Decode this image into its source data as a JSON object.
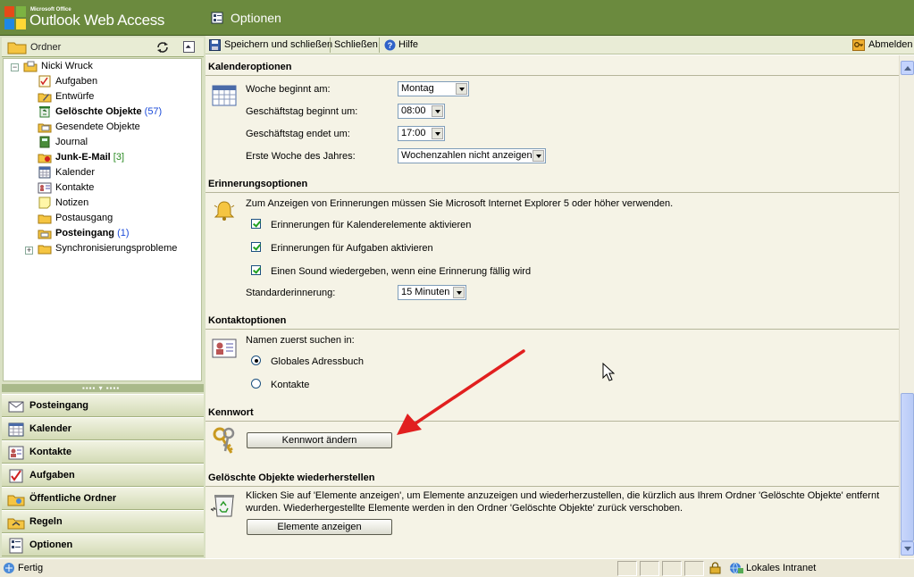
{
  "header": {
    "logo_small": "Microsoft Office",
    "logo_big": "Outlook Web Access",
    "title": "Optionen",
    "colors": {
      "header_bg": "#6b8a3e",
      "accent_red": "#e11f1f"
    }
  },
  "folders": {
    "header_label": "Ordner",
    "root": "Nicki Wruck",
    "items": [
      {
        "label": "Aufgaben",
        "count": "",
        "bold": false,
        "icon": "tasks-icon"
      },
      {
        "label": "Entwürfe",
        "count": "",
        "bold": false,
        "icon": "drafts-icon"
      },
      {
        "label": "Gelöschte Objekte",
        "count": "(57)",
        "bold": true,
        "icon": "deleted-items-icon"
      },
      {
        "label": "Gesendete Objekte",
        "count": "",
        "bold": false,
        "icon": "sent-items-icon"
      },
      {
        "label": "Journal",
        "count": "",
        "bold": false,
        "icon": "journal-icon"
      },
      {
        "label": "Junk-E-Mail",
        "count": "[3]",
        "bold": true,
        "icon": "junk-mail-icon"
      },
      {
        "label": "Kalender",
        "count": "",
        "bold": false,
        "icon": "calendar-icon"
      },
      {
        "label": "Kontakte",
        "count": "",
        "bold": false,
        "icon": "contacts-icon"
      },
      {
        "label": "Notizen",
        "count": "",
        "bold": false,
        "icon": "notes-icon"
      },
      {
        "label": "Postausgang",
        "count": "",
        "bold": false,
        "icon": "outbox-icon"
      },
      {
        "label": "Posteingang",
        "count": "(1)",
        "bold": true,
        "icon": "inbox-icon"
      },
      {
        "label": "Synchronisierungsprobleme",
        "count": "",
        "bold": false,
        "icon": "folder-icon"
      }
    ]
  },
  "nav": {
    "items": [
      {
        "label": "Posteingang",
        "icon": "inbox-icon"
      },
      {
        "label": "Kalender",
        "icon": "calendar-icon"
      },
      {
        "label": "Kontakte",
        "icon": "contacts-icon"
      },
      {
        "label": "Aufgaben",
        "icon": "tasks-icon"
      },
      {
        "label": "Öffentliche Ordner",
        "icon": "public-folders-icon"
      },
      {
        "label": "Regeln",
        "icon": "rules-icon"
      },
      {
        "label": "Optionen",
        "icon": "options-icon"
      }
    ]
  },
  "toolbar": {
    "save_close": "Speichern und schließen",
    "close": "Schließen",
    "help": "Hilfe",
    "logout": "Abmelden"
  },
  "calendar": {
    "title": "Kalenderoptionen",
    "week_start_label": "Woche beginnt am:",
    "week_start_value": "Montag",
    "day_start_label": "Geschäftstag beginnt um:",
    "day_start_value": "08:00",
    "day_end_label": "Geschäftstag endet um:",
    "day_end_value": "17:00",
    "first_week_label": "Erste Woche des Jahres:",
    "first_week_value": "Wochenzahlen nicht anzeigen"
  },
  "reminders": {
    "title": "Erinnerungsoptionen",
    "note": "Zum Anzeigen von Erinnerungen müssen Sie Microsoft Internet Explorer 5 oder höher verwenden.",
    "calendar_reminders": "Erinnerungen für Kalenderelemente aktivieren",
    "task_reminders": "Erinnerungen für Aufgaben aktivieren",
    "play_sound": "Einen Sound wiedergeben, wenn eine Erinnerung fällig wird",
    "default_label": "Standarderinnerung:",
    "default_value": "15 Minuten"
  },
  "contacts": {
    "title": "Kontaktoptionen",
    "search_label": "Namen zuerst suchen in:",
    "option_gal": "Globales Adressbuch",
    "option_contacts": "Kontakte"
  },
  "password": {
    "title": "Kennwort",
    "button": "Kennwort ändern"
  },
  "recover": {
    "title": "Gelöschte Objekte wiederherstellen",
    "text_1": "Klicken Sie auf 'Elemente anzeigen', um Elemente anzuzeigen und wiederherzustellen, die kürzlich aus Ihrem Ordner 'Gelöschte Objekte' entfernt",
    "text_2": "wurden. Wiederhergestellte Elemente werden in den Ordner 'Gelöschte Objekte' zurück verschoben.",
    "button": "Elemente anzeigen"
  },
  "status": {
    "text": "Fertig",
    "zone": "Lokales Intranet"
  }
}
